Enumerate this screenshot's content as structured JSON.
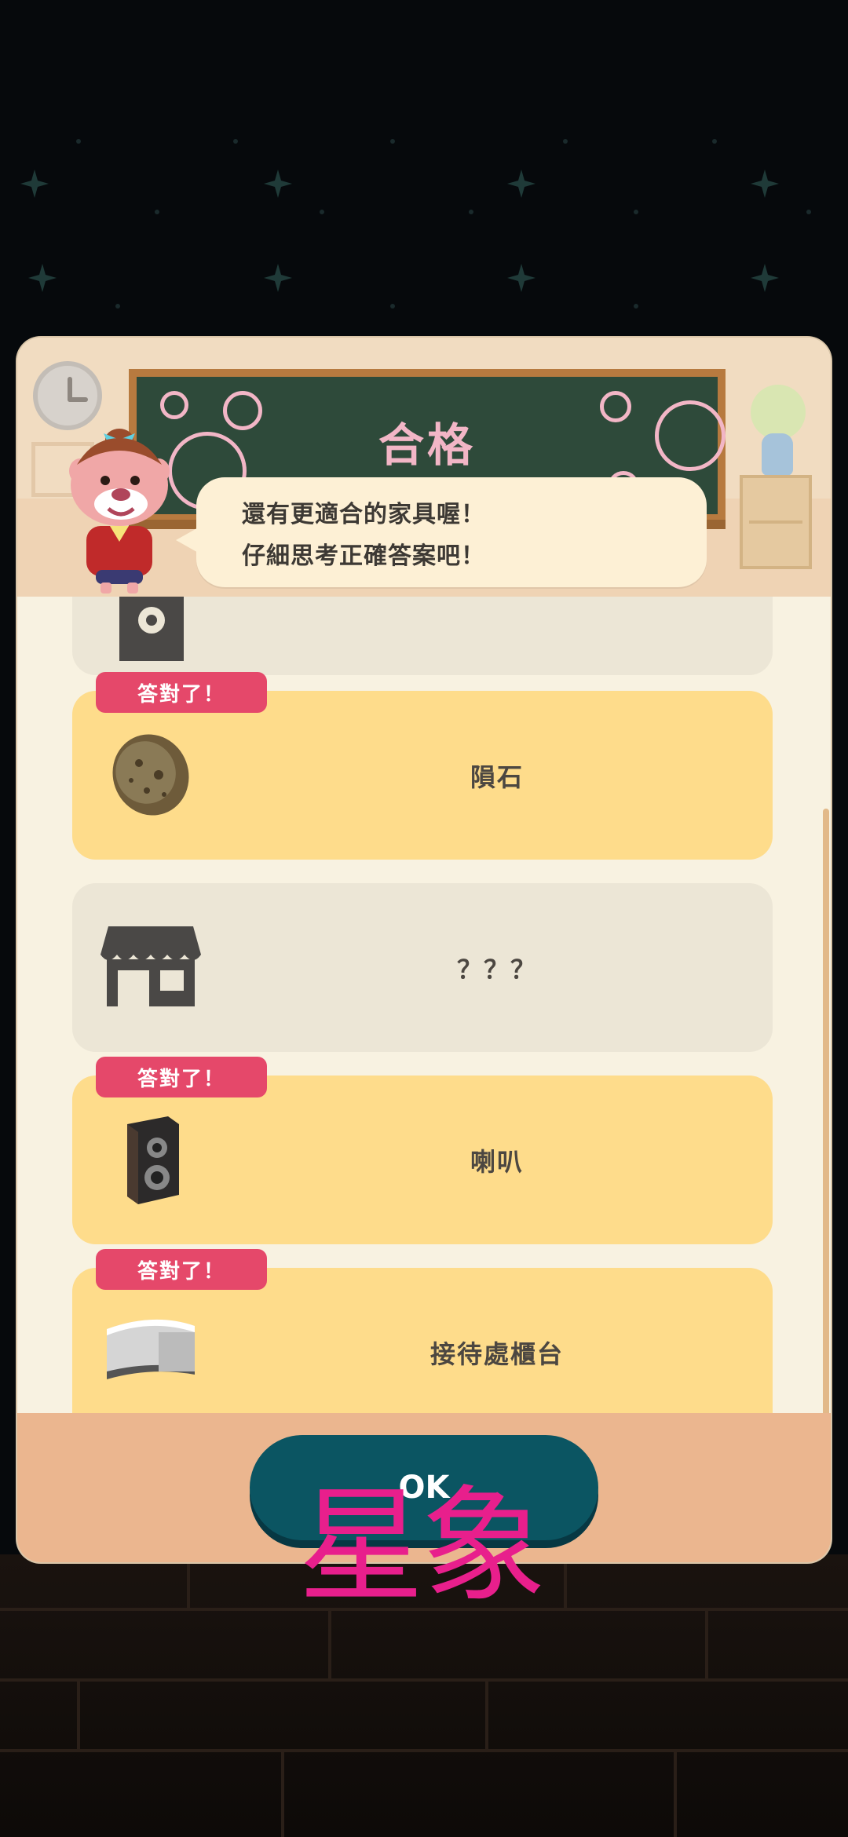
{
  "header": {
    "board_title": "合格",
    "bubble_line1": "還有更適合的家具喔！",
    "bubble_line2": "仔細思考正確答案吧！"
  },
  "items": [
    {
      "name": "？？？",
      "state": "unknown",
      "icon": "speaker-cube-icon"
    },
    {
      "name": "隕石",
      "state": "correct",
      "badge": "答對了！",
      "icon": "meteorite-icon"
    },
    {
      "name": "？？？",
      "state": "unknown",
      "icon": "shop-silhouette-icon"
    },
    {
      "name": "喇叭",
      "state": "correct",
      "badge": "答對了！",
      "icon": "speaker-icon"
    },
    {
      "name": "接待處櫃台",
      "state": "correct",
      "badge": "答對了！",
      "icon": "reception-counter-icon"
    }
  ],
  "footer": {
    "ok_label": "OK"
  },
  "watermark": "星象",
  "colors": {
    "badge": "#e5486a",
    "known_card": "#fedc8b",
    "unknown_card": "#ece6d6",
    "ok_button": "#0b5562",
    "footer": "#ebb68f"
  }
}
